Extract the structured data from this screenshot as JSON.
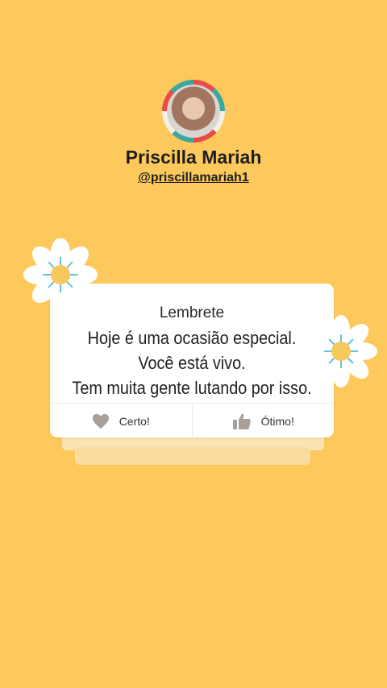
{
  "profile": {
    "name": "Priscilla Mariah",
    "handle": "@priscillamariah1"
  },
  "card": {
    "title": "Lembrete",
    "message_lines": [
      "Hoje é uma ocasião especial.",
      "Você está vivo.",
      "Tem muita gente lutando por isso."
    ],
    "actions": [
      {
        "label": "Certo!",
        "icon": "heart-icon"
      },
      {
        "label": "Ótimo!",
        "icon": "thumbs-up-icon"
      }
    ]
  },
  "colors": {
    "background": "#fdc95c",
    "card": "#ffffff",
    "icon": "#a79f98"
  }
}
